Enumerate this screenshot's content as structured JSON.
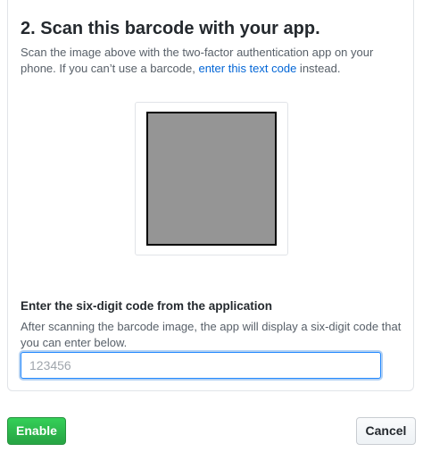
{
  "step": {
    "heading": "2. Scan this barcode with your app.",
    "description_before": "Scan the image above with the two-factor authentication app on your phone. If you can’t use a barcode, ",
    "text_code_link": "enter this text code",
    "description_after": " instead."
  },
  "code_entry": {
    "label": "Enter the six-digit code from the application",
    "hint": "After scanning the barcode image, the app will display a six-digit code that you can enter below.",
    "placeholder": "123456",
    "value": ""
  },
  "actions": {
    "enable_label": "Enable",
    "cancel_label": "Cancel"
  },
  "colors": {
    "link": "#0366d6",
    "primary_button": "#28a745",
    "input_focus": "#2188ff",
    "barcode_fill": "#959595"
  }
}
